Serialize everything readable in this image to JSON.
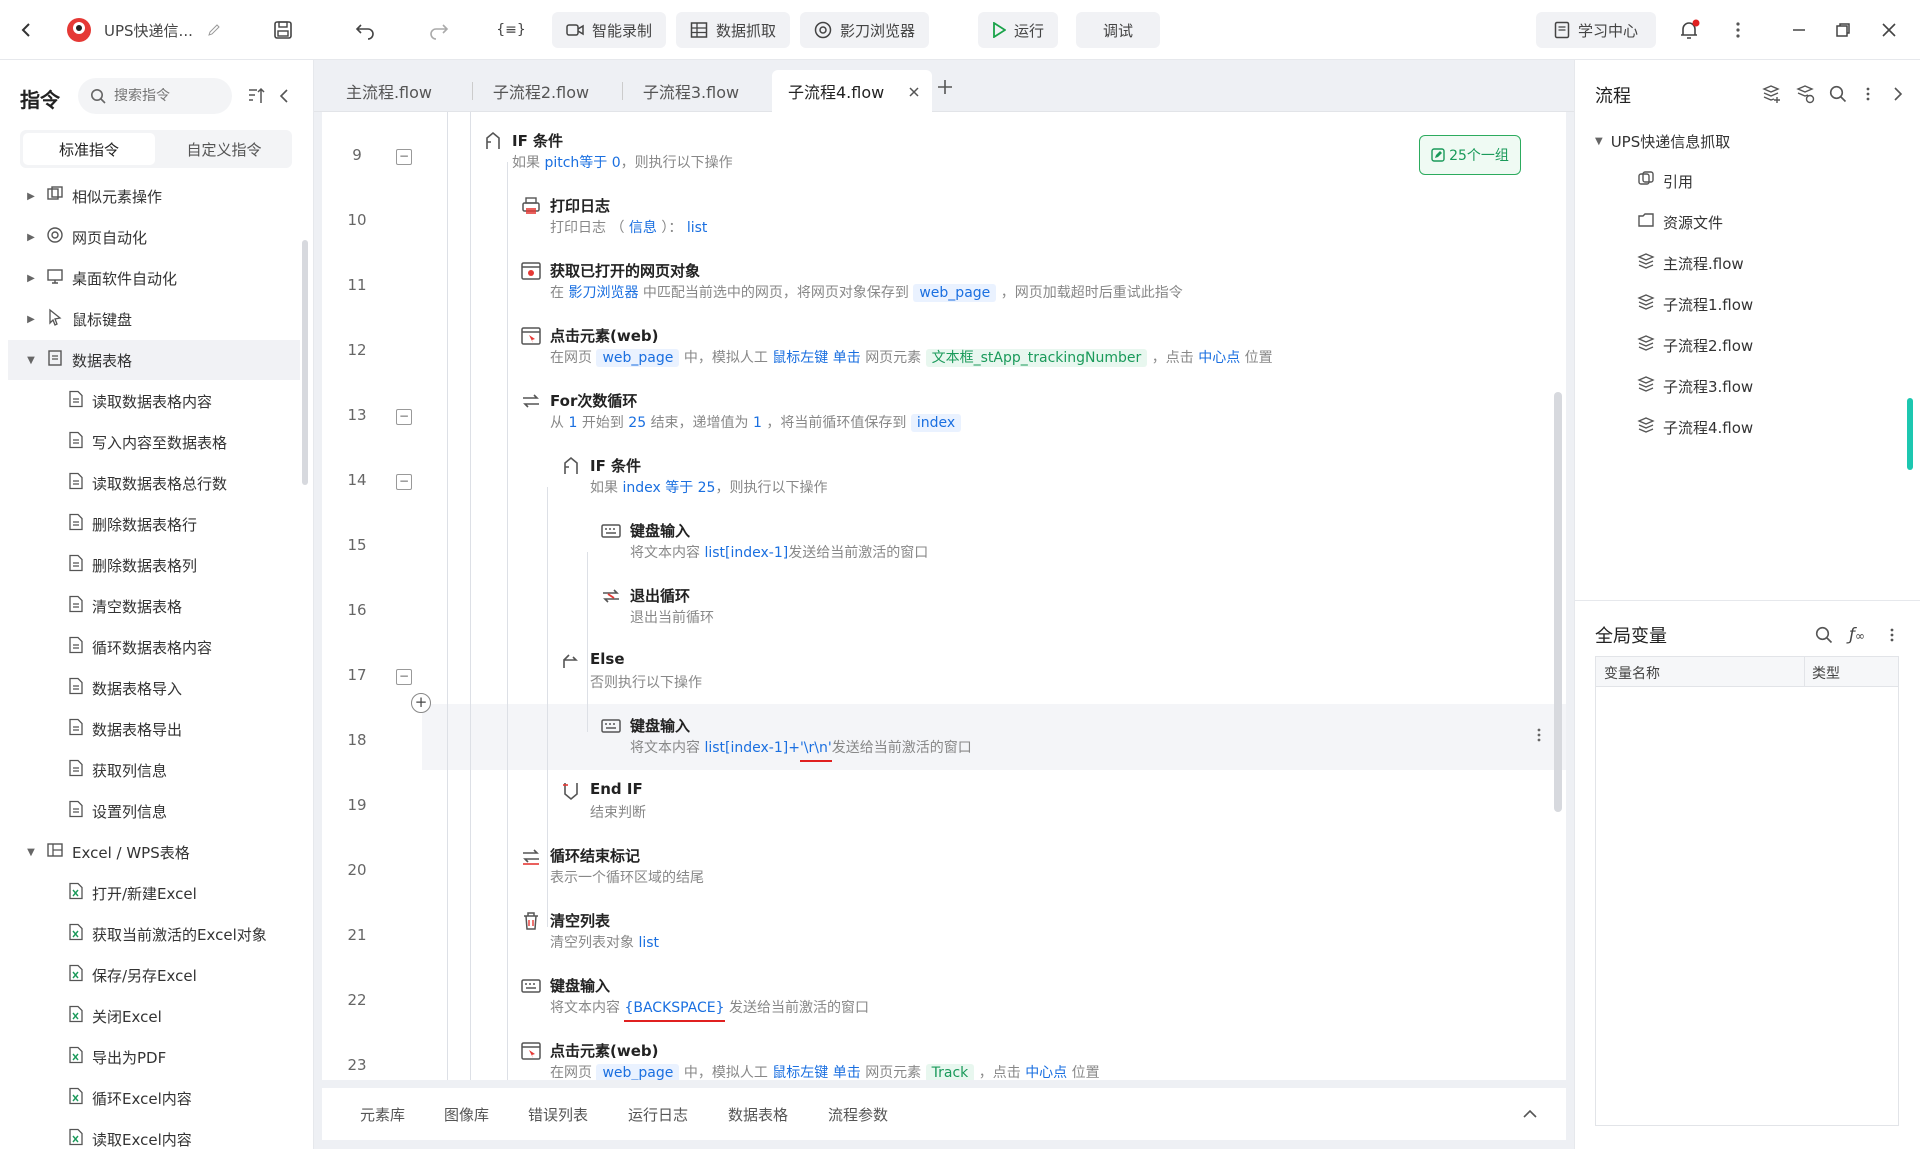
{
  "topbar": {
    "project_title": "UPS快递信...",
    "smart_record": "智能录制",
    "data_capture": "数据抓取",
    "browser": "影刀浏览器",
    "run": "运行",
    "debug": "调试",
    "learning_center": "学习中心",
    "code_icon_label": "{≡}"
  },
  "left": {
    "title": "指令",
    "search_placeholder": "搜索指令",
    "tab_standard": "标准指令",
    "tab_custom": "自定义指令",
    "tree": [
      {
        "label": "相似元素操作",
        "level": 0,
        "expanded": false
      },
      {
        "label": "网页自动化",
        "level": 0,
        "expanded": false
      },
      {
        "label": "桌面软件自动化",
        "level": 0,
        "expanded": false
      },
      {
        "label": "鼠标键盘",
        "level": 0,
        "expanded": false
      },
      {
        "label": "数据表格",
        "level": 0,
        "expanded": true
      },
      {
        "label": "读取数据表格内容",
        "level": 1
      },
      {
        "label": "写入内容至数据表格",
        "level": 1
      },
      {
        "label": "读取数据表格总行数",
        "level": 1
      },
      {
        "label": "删除数据表格行",
        "level": 1
      },
      {
        "label": "删除数据表格列",
        "level": 1
      },
      {
        "label": "清空数据表格",
        "level": 1
      },
      {
        "label": "循环数据表格内容",
        "level": 1
      },
      {
        "label": "数据表格导入",
        "level": 1
      },
      {
        "label": "数据表格导出",
        "level": 1
      },
      {
        "label": "获取列信息",
        "level": 1
      },
      {
        "label": "设置列信息",
        "level": 1
      },
      {
        "label": "Excel / WPS表格",
        "level": 0,
        "expanded": true
      },
      {
        "label": "打开/新建Excel",
        "level": 1
      },
      {
        "label": "获取当前激活的Excel对象",
        "level": 1
      },
      {
        "label": "保存/另存Excel",
        "level": 1
      },
      {
        "label": "关闭Excel",
        "level": 1
      },
      {
        "label": "导出为PDF",
        "level": 1
      },
      {
        "label": "循环Excel内容",
        "level": 1
      },
      {
        "label": "读取Excel内容",
        "level": 1
      }
    ]
  },
  "tabs": [
    {
      "label": "主流程.flow",
      "active": false
    },
    {
      "label": "子流程2.flow",
      "active": false
    },
    {
      "label": "子流程3.flow",
      "active": false
    },
    {
      "label": "子流程4.flow",
      "active": true
    }
  ],
  "group_badge": "25个一组",
  "lines": [
    "9",
    "10",
    "11",
    "12",
    "13",
    "14",
    "15",
    "16",
    "17",
    "18",
    "19",
    "20",
    "21",
    "22",
    "23"
  ],
  "nodes": {
    "n9": {
      "title": "IF 条件",
      "d1": "如果",
      "d2": "pitch等于 0",
      "d3": "，则执行以下操作"
    },
    "n10": {
      "title": "打印日志",
      "d1": "打印日志",
      "d2": "（",
      "d3": "信息",
      "d4": "）：",
      "d5": "list"
    },
    "n11": {
      "title": "获取已打开的网页对象",
      "d1": "在",
      "d2": "影刀浏览器",
      "d3": "中匹配当前选中的网页，将网页对象保存到",
      "d4": "web_page",
      "d5": "，网页加载超时后重试此指令"
    },
    "n12": {
      "title": "点击元素(web)",
      "d1": "在网页",
      "d2": "web_page",
      "d3": "中，模拟人工",
      "d4": "鼠标左键 单击",
      "d5": "网页元素",
      "d6": "文本框_stApp_trackingNumber",
      "d7": "，点击",
      "d8": "中心点",
      "d9": "位置"
    },
    "n13": {
      "title": "For次数循环",
      "d1": "从",
      "d2": "1",
      "d3": "开始到",
      "d4": "25",
      "d5": "结束，递增值为",
      "d6": "1",
      "d7": "，将当前循环值保存到",
      "d8": "index"
    },
    "n14": {
      "title": "IF 条件",
      "d1": "如果",
      "d2": "index 等于 25",
      "d3": "，则执行以下操作"
    },
    "n15": {
      "title": "键盘输入",
      "d1": "将文本内容",
      "d2": "list[index-1]",
      "d3": "发送给当前激活的窗口"
    },
    "n16": {
      "title": "退出循环",
      "d1": "退出当前循环"
    },
    "n17": {
      "title": "Else",
      "d1": "否则执行以下操作"
    },
    "n18": {
      "title": "键盘输入",
      "d1": "将文本内容",
      "d2": "list[index-1]+",
      "d3": "'\\r\\n'",
      "d4": "发送给当前激活的窗口"
    },
    "n19": {
      "title": "End IF",
      "d1": "结束判断"
    },
    "n20": {
      "title": "循环结束标记",
      "d1": "表示一个循环区域的结尾"
    },
    "n21": {
      "title": "清空列表",
      "d1": "清空列表对象",
      "d2": "list"
    },
    "n22": {
      "title": "键盘输入",
      "d1": "将文本内容",
      "d2": "{BACKSPACE}",
      "d3": "发送给当前激活的窗口"
    },
    "n23": {
      "title": "点击元素(web)",
      "d1": "在网页",
      "d2": "web_page",
      "d3": "中，模拟人工",
      "d4": "鼠标左键 单击",
      "d5": "网页元素",
      "d6": "Track",
      "d7": "，点击",
      "d8": "中心点",
      "d9": "位置"
    }
  },
  "bottom_tabs": [
    "元素库",
    "图像库",
    "错误列表",
    "运行日志",
    "数据表格",
    "流程参数"
  ],
  "right": {
    "flow_title": "流程",
    "project": "UPS快递信息抓取",
    "items": [
      "引用",
      "资源文件",
      "主流程.flow",
      "子流程1.flow",
      "子流程2.flow",
      "子流程3.flow",
      "子流程4.flow"
    ],
    "vars_title": "全局变量",
    "col_name": "变量名称",
    "col_type": "类型"
  },
  "colors": {
    "accent": "#1a6fe0",
    "green": "#1a9a5a",
    "run_green": "#1aa34a",
    "red_mark": "#e02020"
  }
}
